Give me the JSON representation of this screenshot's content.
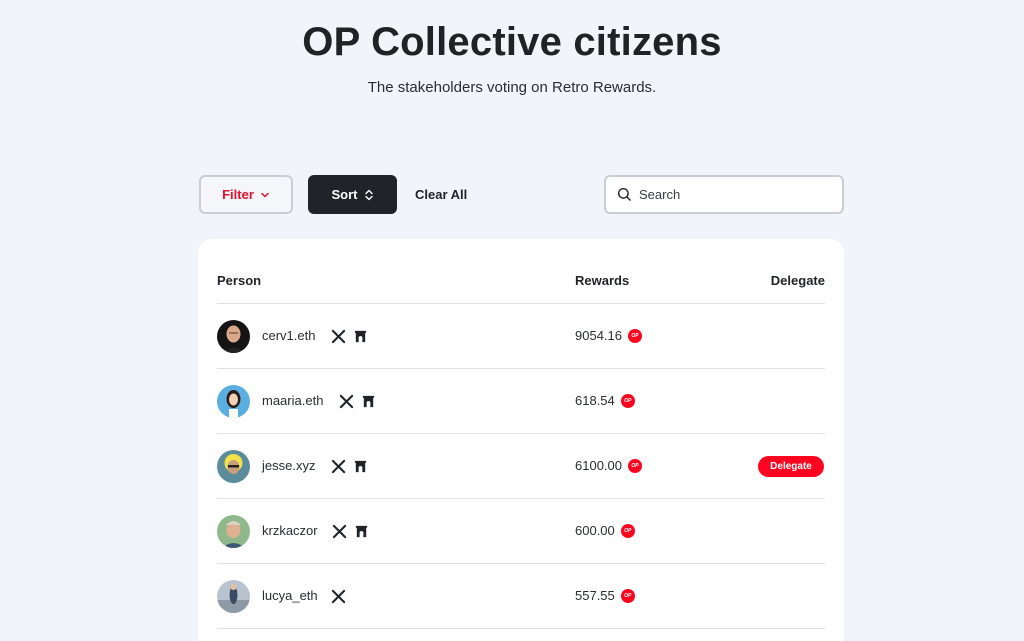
{
  "header": {
    "title": "OP Collective citizens",
    "subtitle": "The stakeholders voting on Retro Rewards."
  },
  "toolbar": {
    "filter_label": "Filter",
    "sort_label": "Sort",
    "clear_label": "Clear All",
    "search_placeholder": "Search"
  },
  "table": {
    "columns": [
      "Person",
      "Rewards",
      "Delegate"
    ],
    "rows": [
      {
        "name": "cerv1.eth",
        "reward": "9054.16",
        "icons": [
          "x-icon",
          "farcaster-icon"
        ],
        "delegate": ""
      },
      {
        "name": "maaria.eth",
        "reward": "618.54",
        "icons": [
          "x-icon",
          "farcaster-icon"
        ],
        "delegate": ""
      },
      {
        "name": "jesse.xyz",
        "reward": "6100.00",
        "icons": [
          "x-icon",
          "farcaster-icon"
        ],
        "delegate": "Delegate"
      },
      {
        "name": "krzkaczor",
        "reward": "600.00",
        "icons": [
          "x-icon",
          "farcaster-icon"
        ],
        "delegate": ""
      },
      {
        "name": "lucya_eth",
        "reward": "557.55",
        "icons": [
          "x-icon"
        ],
        "delegate": ""
      }
    ]
  },
  "token_badge": "OP",
  "colors": {
    "accent": "#ff0420",
    "dark_button": "#202428",
    "background": "#f1f4f9"
  }
}
